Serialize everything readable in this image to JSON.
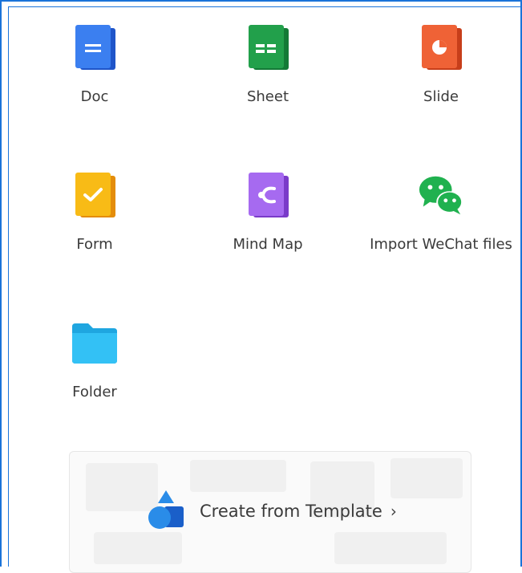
{
  "tiles": [
    {
      "label": "Doc",
      "icon": "doc-icon",
      "color": "#2f6ee6"
    },
    {
      "label": "Sheet",
      "icon": "sheet-icon",
      "color": "#22a04b"
    },
    {
      "label": "Slide",
      "icon": "slide-icon",
      "color": "#ea5a2e"
    },
    {
      "label": "Form",
      "icon": "form-icon",
      "color": "#f5b70f"
    },
    {
      "label": "Mind Map",
      "icon": "mindmap-icon",
      "color": "#9a5ae6"
    },
    {
      "label": "Import WeChat files",
      "icon": "wechat-icon",
      "color": "#1fb34f"
    },
    {
      "label": "Folder",
      "icon": "folder-icon",
      "color": "#29b6f0"
    }
  ],
  "template": {
    "label": "Create from Template",
    "icon": "template-shapes-icon",
    "chevron": "›"
  },
  "colors": {
    "frame": "#1a73d9",
    "text": "#3a3a3a"
  }
}
